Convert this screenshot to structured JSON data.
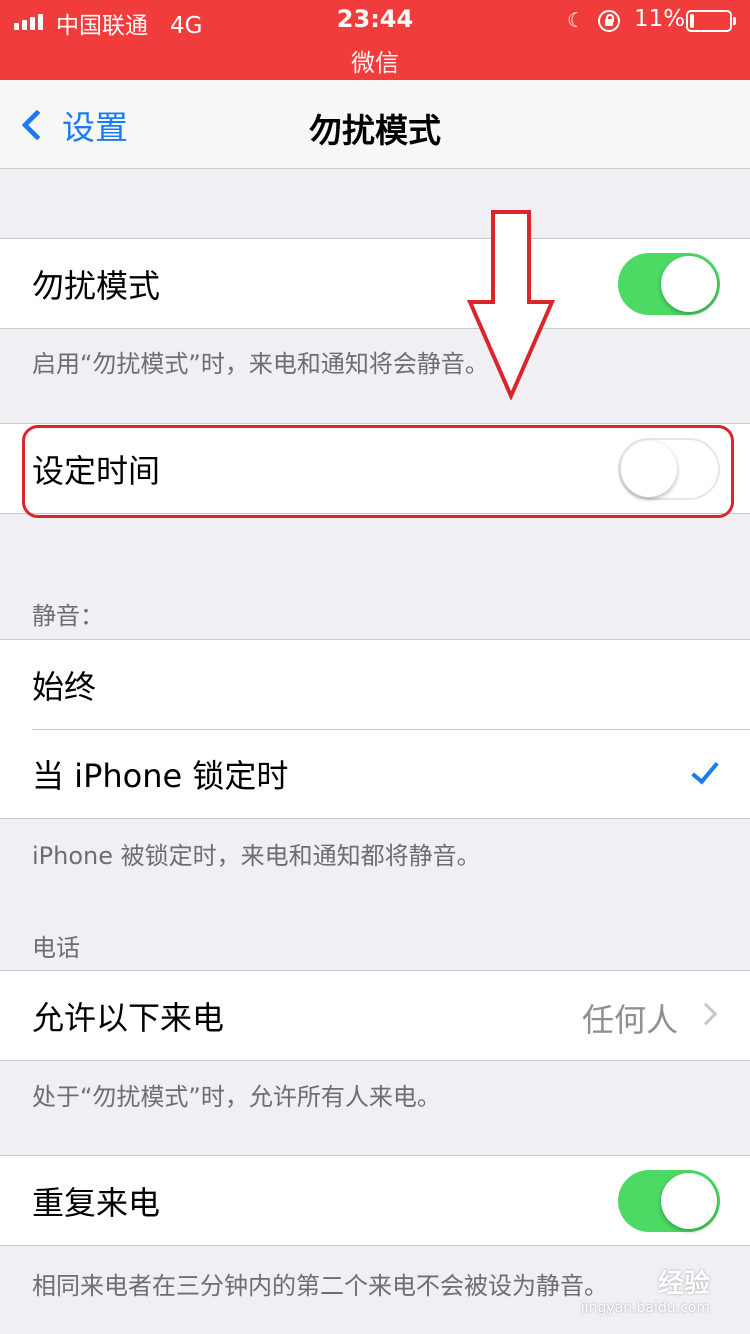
{
  "status_bar": {
    "carrier": "中国联通",
    "network": "4G",
    "time": "23:44",
    "return_app": "微信",
    "battery_percent": "11%",
    "battery_level": 0.11,
    "icons": [
      "signal-icon",
      "moon-icon",
      "orientation-lock-icon",
      "battery-icon"
    ],
    "background_color": "#f03c3a"
  },
  "nav": {
    "back_label": "设置",
    "title": "勿扰模式"
  },
  "sections": {
    "dnd": {
      "label": "勿扰模式",
      "enabled": true,
      "footer": "启用“勿扰模式”时，来电和通知将会静音。"
    },
    "scheduled": {
      "label": "设定时间",
      "enabled": false
    },
    "silence": {
      "header": "静音：",
      "options": [
        "始终",
        "当 iPhone 锁定时"
      ],
      "selected": "当 iPhone 锁定时",
      "footer": "iPhone 被锁定时，来电和通知都将静音。"
    },
    "phone": {
      "header": "电话",
      "allow_calls_label": "允许以下来电",
      "allow_calls_value": "任何人",
      "footer": "处于“勿扰模式”时，允许所有人来电。"
    },
    "repeated": {
      "label": "重复来电",
      "enabled": true,
      "footer": "相同来电者在三分钟内的第二个来电不会被设为静音。"
    }
  },
  "watermark": {
    "text": "经验",
    "url": "jingyan.baidu.com"
  },
  "colors": {
    "accent": "#1a7cf5",
    "toggle_on": "#4cd964",
    "annotation": "#d9252b",
    "background": "#efeff4"
  }
}
